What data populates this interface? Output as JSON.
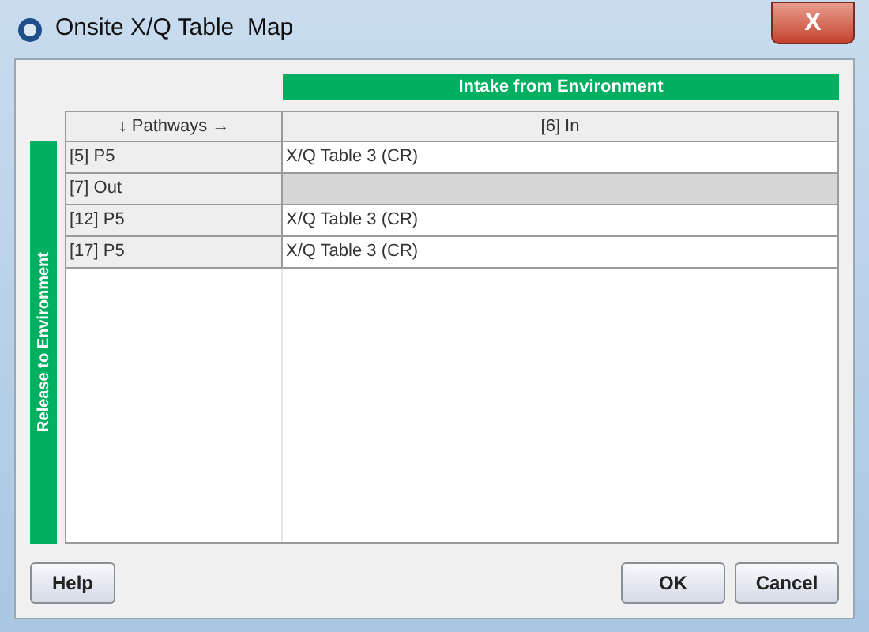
{
  "window": {
    "title": "Onsite X/Q Table  Map",
    "close": "X"
  },
  "column_banner": "Intake from Environment",
  "row_banner": "Release to Environment",
  "table": {
    "columns": [
      "↓ Pathways →",
      "[6] In"
    ],
    "rows": [
      {
        "label": "[5] P5",
        "value": "X/Q Table 3 (CR)",
        "disabled": false
      },
      {
        "label": "[7] Out",
        "disabled": true
      },
      {
        "label": "[12] P5",
        "value": "X/Q Table 3 (CR)",
        "disabled": false
      },
      {
        "label": "[17] P5",
        "value": "X/Q Table 3 (CR)",
        "disabled": false
      }
    ]
  },
  "buttons": {
    "help": "Help",
    "ok": "OK",
    "cancel": "Cancel"
  }
}
